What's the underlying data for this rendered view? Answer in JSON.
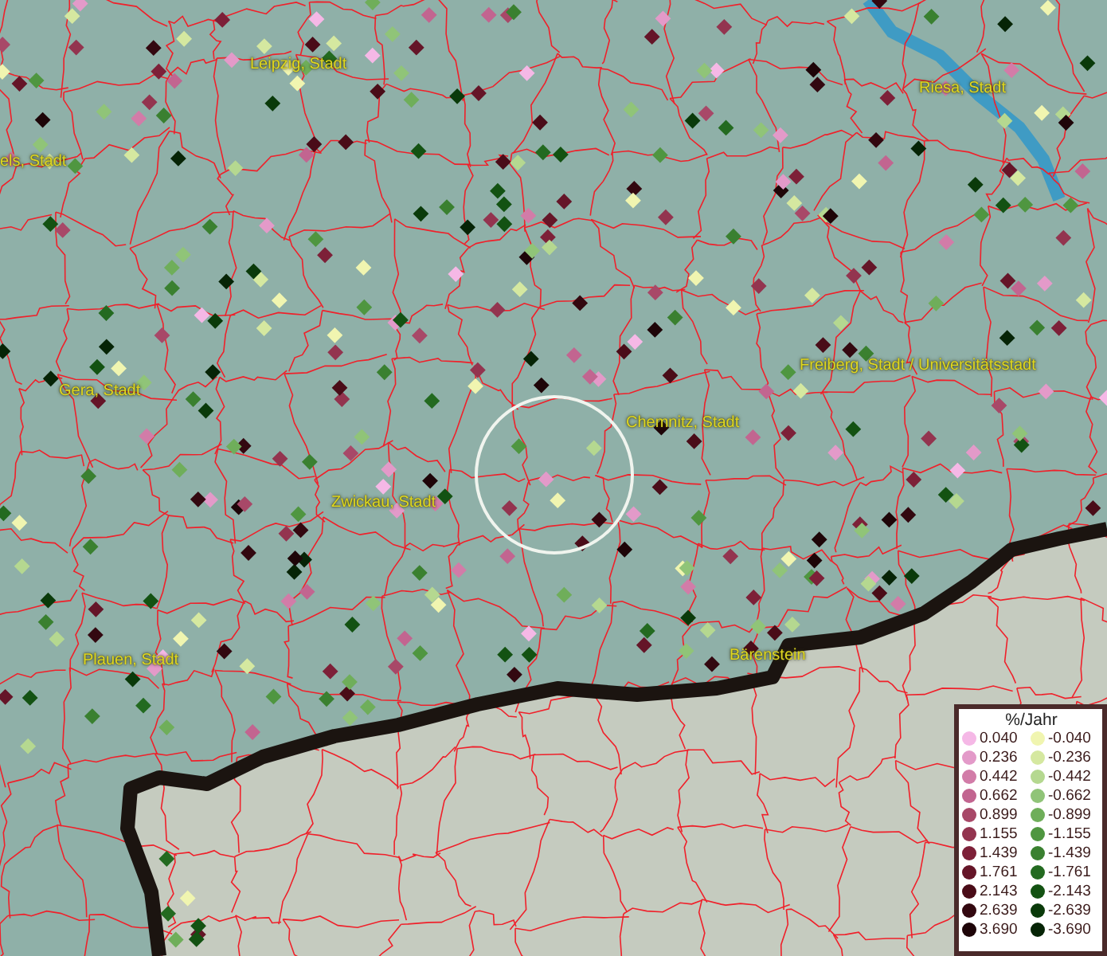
{
  "map": {
    "cities": [
      {
        "name": "Leipzig, Stadt"
      },
      {
        "name": "els, Stadt"
      },
      {
        "name": "Riesa, Stadt"
      },
      {
        "name": "Gera, Stadt"
      },
      {
        "name": "Freiberg, Stadt / Universitätsstadt"
      },
      {
        "name": "Chemnitz, Stadt"
      },
      {
        "name": "Zwickau, Stadt"
      },
      {
        "name": "Plauen, Stadt"
      },
      {
        "name": "Bärenstein"
      }
    ]
  },
  "legend": {
    "title": "%/Jahr",
    "positive": [
      {
        "value": "0.040",
        "color": "#f5b8e6"
      },
      {
        "value": "0.236",
        "color": "#e39ac9"
      },
      {
        "value": "0.442",
        "color": "#d27ca8"
      },
      {
        "value": "0.662",
        "color": "#c26590"
      },
      {
        "value": "0.899",
        "color": "#a84868"
      },
      {
        "value": "1.155",
        "color": "#93344f"
      },
      {
        "value": "1.439",
        "color": "#7d2038"
      },
      {
        "value": "1.761",
        "color": "#651528"
      },
      {
        "value": "2.143",
        "color": "#4a0c18"
      },
      {
        "value": "2.639",
        "color": "#330810"
      },
      {
        "value": "3.690",
        "color": "#1e0508"
      }
    ],
    "negative": [
      {
        "value": "-0.040",
        "color": "#f0f5b0"
      },
      {
        "value": "-0.236",
        "color": "#d5e8a0"
      },
      {
        "value": "-0.442",
        "color": "#b5d890"
      },
      {
        "value": "-0.662",
        "color": "#90c478"
      },
      {
        "value": "-0.899",
        "color": "#6fae5a"
      },
      {
        "value": "-1.155",
        "color": "#4f9640"
      },
      {
        "value": "-1.439",
        "color": "#3a8030"
      },
      {
        "value": "-1.761",
        "color": "#236a20"
      },
      {
        "value": "-2.143",
        "color": "#135212"
      },
      {
        "value": "-2.639",
        "color": "#0a3a0a"
      },
      {
        "value": "-3.690",
        "color": "#062406"
      }
    ]
  }
}
